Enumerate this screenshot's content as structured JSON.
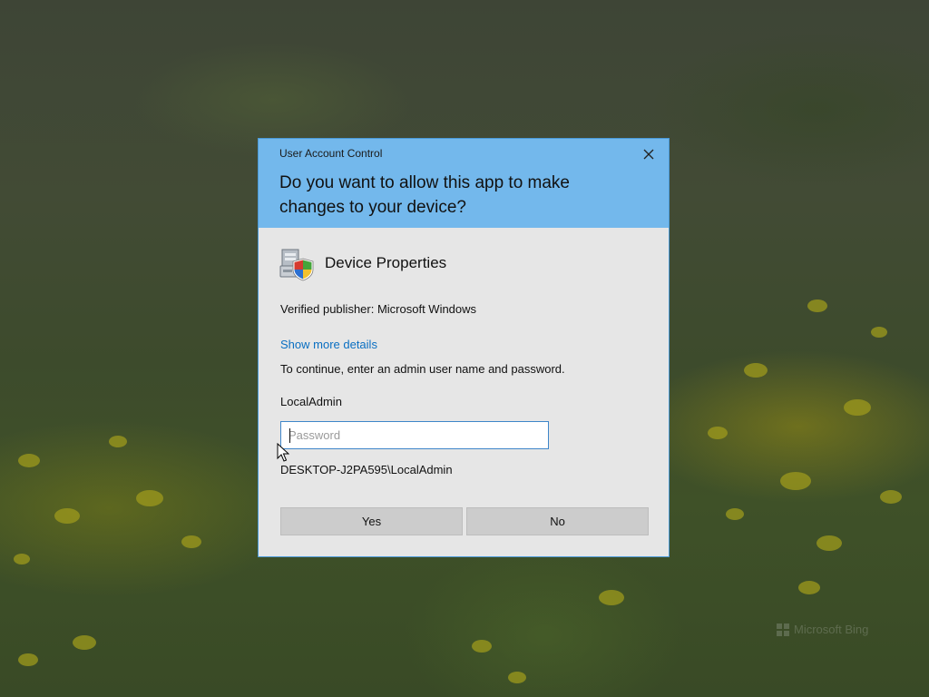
{
  "desktop": {
    "watermark_text": "Microsoft Bing"
  },
  "dialog": {
    "caption": "User Account Control",
    "close_label": "×",
    "question": "Do you want to allow this app to make changes to your device?",
    "app_name": "Device Properties",
    "publisher_line": "Verified publisher: Microsoft Windows",
    "details_link": "Show more details",
    "instruction": "To continue, enter an admin user name and password.",
    "username": "LocalAdmin",
    "password": {
      "value": "",
      "placeholder": "Password"
    },
    "domain_line": "DESKTOP-J2PA595\\LocalAdmin",
    "buttons": {
      "yes": "Yes",
      "no": "No"
    }
  },
  "colors": {
    "header": "#73b8ec",
    "body": "#e6e6e6",
    "link": "#0a6fc2",
    "button": "#cccccc",
    "input_border": "#3f86c9"
  },
  "icons": {
    "app_icon": "device-properties-shield-icon",
    "close_icon": "close-icon",
    "cursor": "mouse-pointer-icon"
  }
}
